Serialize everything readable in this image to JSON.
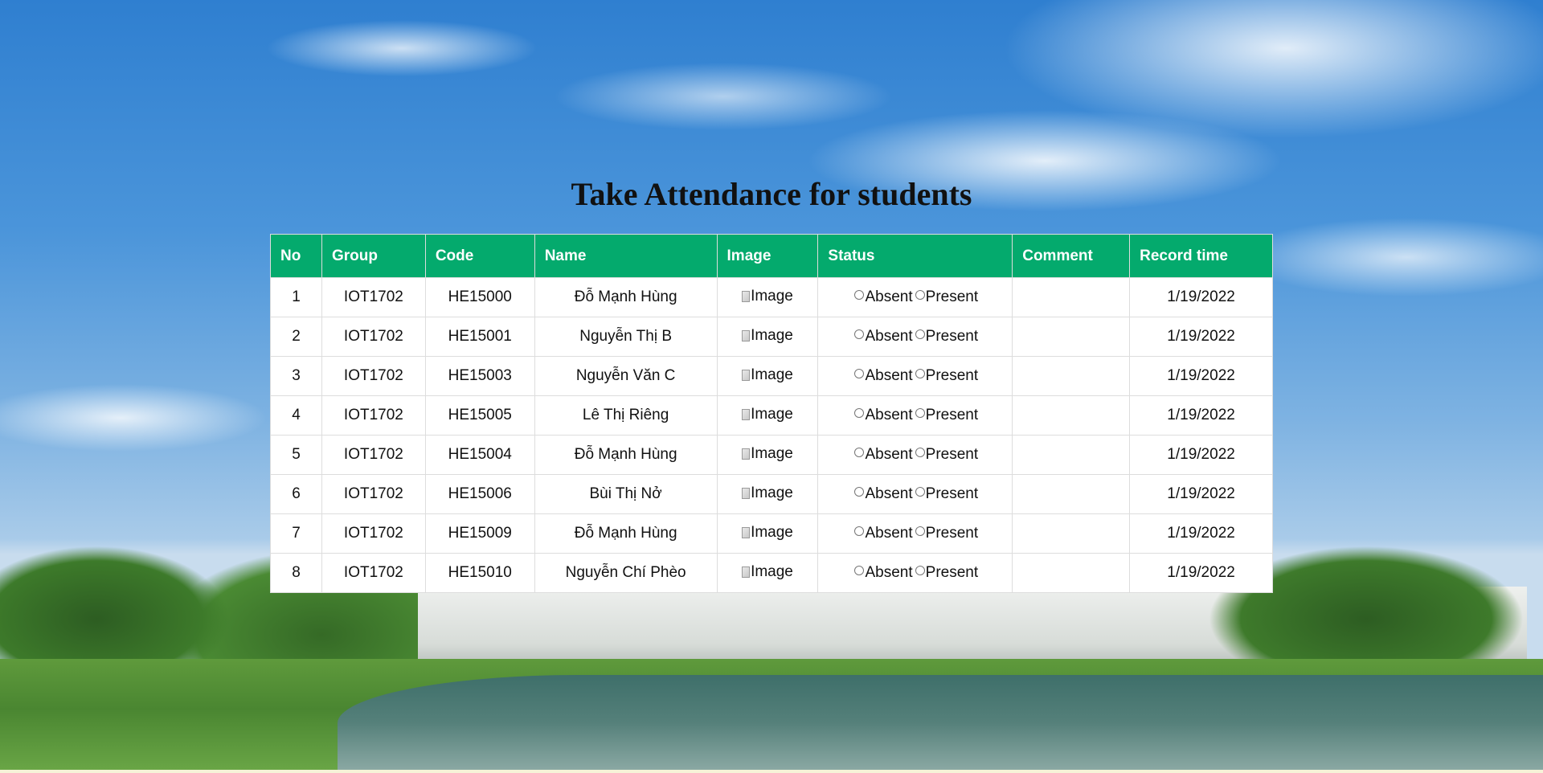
{
  "page": {
    "title": "Take Attendance for students"
  },
  "table": {
    "headers": [
      "No",
      "Group",
      "Code",
      "Name",
      "Image",
      "Status",
      "Comment",
      "Record time"
    ],
    "status_options": [
      "Absent",
      "Present"
    ],
    "rows": [
      {
        "no": "1",
        "group": "IOT1702",
        "code": "HE15000",
        "name": "Đỗ Mạnh Hùng",
        "image_alt": "Image",
        "comment": "",
        "record_time": "1/19/2022"
      },
      {
        "no": "2",
        "group": "IOT1702",
        "code": "HE15001",
        "name": "Nguyễn Thị B",
        "image_alt": "Image",
        "comment": "",
        "record_time": "1/19/2022"
      },
      {
        "no": "3",
        "group": "IOT1702",
        "code": "HE15003",
        "name": "Nguyễn Văn C",
        "image_alt": "Image",
        "comment": "",
        "record_time": "1/19/2022"
      },
      {
        "no": "4",
        "group": "IOT1702",
        "code": "HE15005",
        "name": "Lê Thị Riêng",
        "image_alt": "Image",
        "comment": "",
        "record_time": "1/19/2022"
      },
      {
        "no": "5",
        "group": "IOT1702",
        "code": "HE15004",
        "name": "Đỗ Mạnh Hùng",
        "image_alt": "Image",
        "comment": "",
        "record_time": "1/19/2022"
      },
      {
        "no": "6",
        "group": "IOT1702",
        "code": "HE15006",
        "name": "Bùi Thị Nở",
        "image_alt": "Image",
        "comment": "",
        "record_time": "1/19/2022"
      },
      {
        "no": "7",
        "group": "IOT1702",
        "code": "HE15009",
        "name": "Đỗ Mạnh Hùng",
        "image_alt": "Image",
        "comment": "",
        "record_time": "1/19/2022"
      },
      {
        "no": "8",
        "group": "IOT1702",
        "code": "HE15010",
        "name": "Nguyễn Chí Phèo",
        "image_alt": "Image",
        "comment": "",
        "record_time": "1/19/2022"
      }
    ]
  },
  "colors": {
    "header_bg": "#04aa6d",
    "header_text": "#ffffff",
    "row_bg": "#ffffff",
    "border": "#dddddd"
  },
  "icons": {
    "radio": "radio-unchecked-icon",
    "broken_image": "broken-image-icon"
  }
}
